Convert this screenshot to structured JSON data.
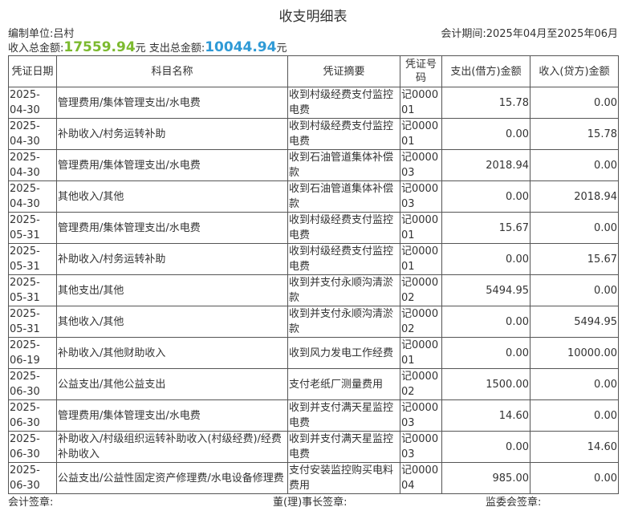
{
  "header": {
    "title": "收支明细表",
    "unit_label": "编制单位:",
    "unit_value": "吕村",
    "period_label": "会计期间:",
    "period_value": "2025年04月至2025年06月",
    "income_label": "收入总金额:",
    "income_value": "17559.94",
    "income_unit": "元",
    "expense_label": "支出总金额:",
    "expense_value": "10044.94",
    "expense_unit": "元"
  },
  "table": {
    "columns": [
      "凭证日期",
      "科目名称",
      "凭证摘要",
      "凭证号码",
      "支出(借方)金额",
      "收入(贷方)金额"
    ],
    "rows": [
      {
        "date": "2025-04-30",
        "subject": "管理费用/集体管理支出/水电费",
        "summary": "收到村级经费支付监控电费",
        "voucher": "记000001",
        "debit": "15.78",
        "credit": "0.00"
      },
      {
        "date": "2025-04-30",
        "subject": "补助收入/村务运转补助",
        "summary": "收到村级经费支付监控电费",
        "voucher": "记000001",
        "debit": "0.00",
        "credit": "15.78"
      },
      {
        "date": "2025-04-30",
        "subject": "管理费用/集体管理支出/水电费",
        "summary": "收到石油管道集体补偿款",
        "voucher": "记000003",
        "debit": "2018.94",
        "credit": "0.00"
      },
      {
        "date": "2025-04-30",
        "subject": "其他收入/其他",
        "summary": "收到石油管道集体补偿款",
        "voucher": "记000003",
        "debit": "0.00",
        "credit": "2018.94"
      },
      {
        "date": "2025-05-31",
        "subject": "管理费用/集体管理支出/水电费",
        "summary": "收到村级经费支付监控电费",
        "voucher": "记000001",
        "debit": "15.67",
        "credit": "0.00"
      },
      {
        "date": "2025-05-31",
        "subject": "补助收入/村务运转补助",
        "summary": "收到村级经费支付监控电费",
        "voucher": "记000001",
        "debit": "0.00",
        "credit": "15.67"
      },
      {
        "date": "2025-05-31",
        "subject": "其他支出/其他",
        "summary": "收到并支付永顺沟清淤款",
        "voucher": "记000002",
        "debit": "5494.95",
        "credit": "0.00"
      },
      {
        "date": "2025-05-31",
        "subject": "其他收入/其他",
        "summary": "收到并支付永顺沟清淤款",
        "voucher": "记000002",
        "debit": "0.00",
        "credit": "5494.95"
      },
      {
        "date": "2025-06-19",
        "subject": "补助收入/其他财助收入",
        "summary": "收到风力发电工作经费",
        "voucher": "记000001",
        "debit": "0.00",
        "credit": "10000.00"
      },
      {
        "date": "2025-06-30",
        "subject": "公益支出/其他公益支出",
        "summary": "支付老纸厂测量费用",
        "voucher": "记000002",
        "debit": "1500.00",
        "credit": "0.00"
      },
      {
        "date": "2025-06-30",
        "subject": "管理费用/集体管理支出/水电费",
        "summary": "收到并支付满天星监控电费",
        "voucher": "记000003",
        "debit": "14.60",
        "credit": "0.00"
      },
      {
        "date": "2025-06-30",
        "subject": "补助收入/村级组织运转补助收入(村级经费)/经费补助收入",
        "summary": "收到并支付满天星监控电费",
        "voucher": "记000003",
        "debit": "0.00",
        "credit": "14.60"
      },
      {
        "date": "2025-06-30",
        "subject": "公益支出/公益性固定资产修理费/水电设备修理费",
        "summary": "支付安装监控购买电料费用",
        "voucher": "记000004",
        "debit": "985.00",
        "credit": "0.00"
      }
    ]
  },
  "footer": {
    "accountant": "会计签章:",
    "director": "董(理)事长签章:",
    "supervisor": "监委会签章:"
  }
}
